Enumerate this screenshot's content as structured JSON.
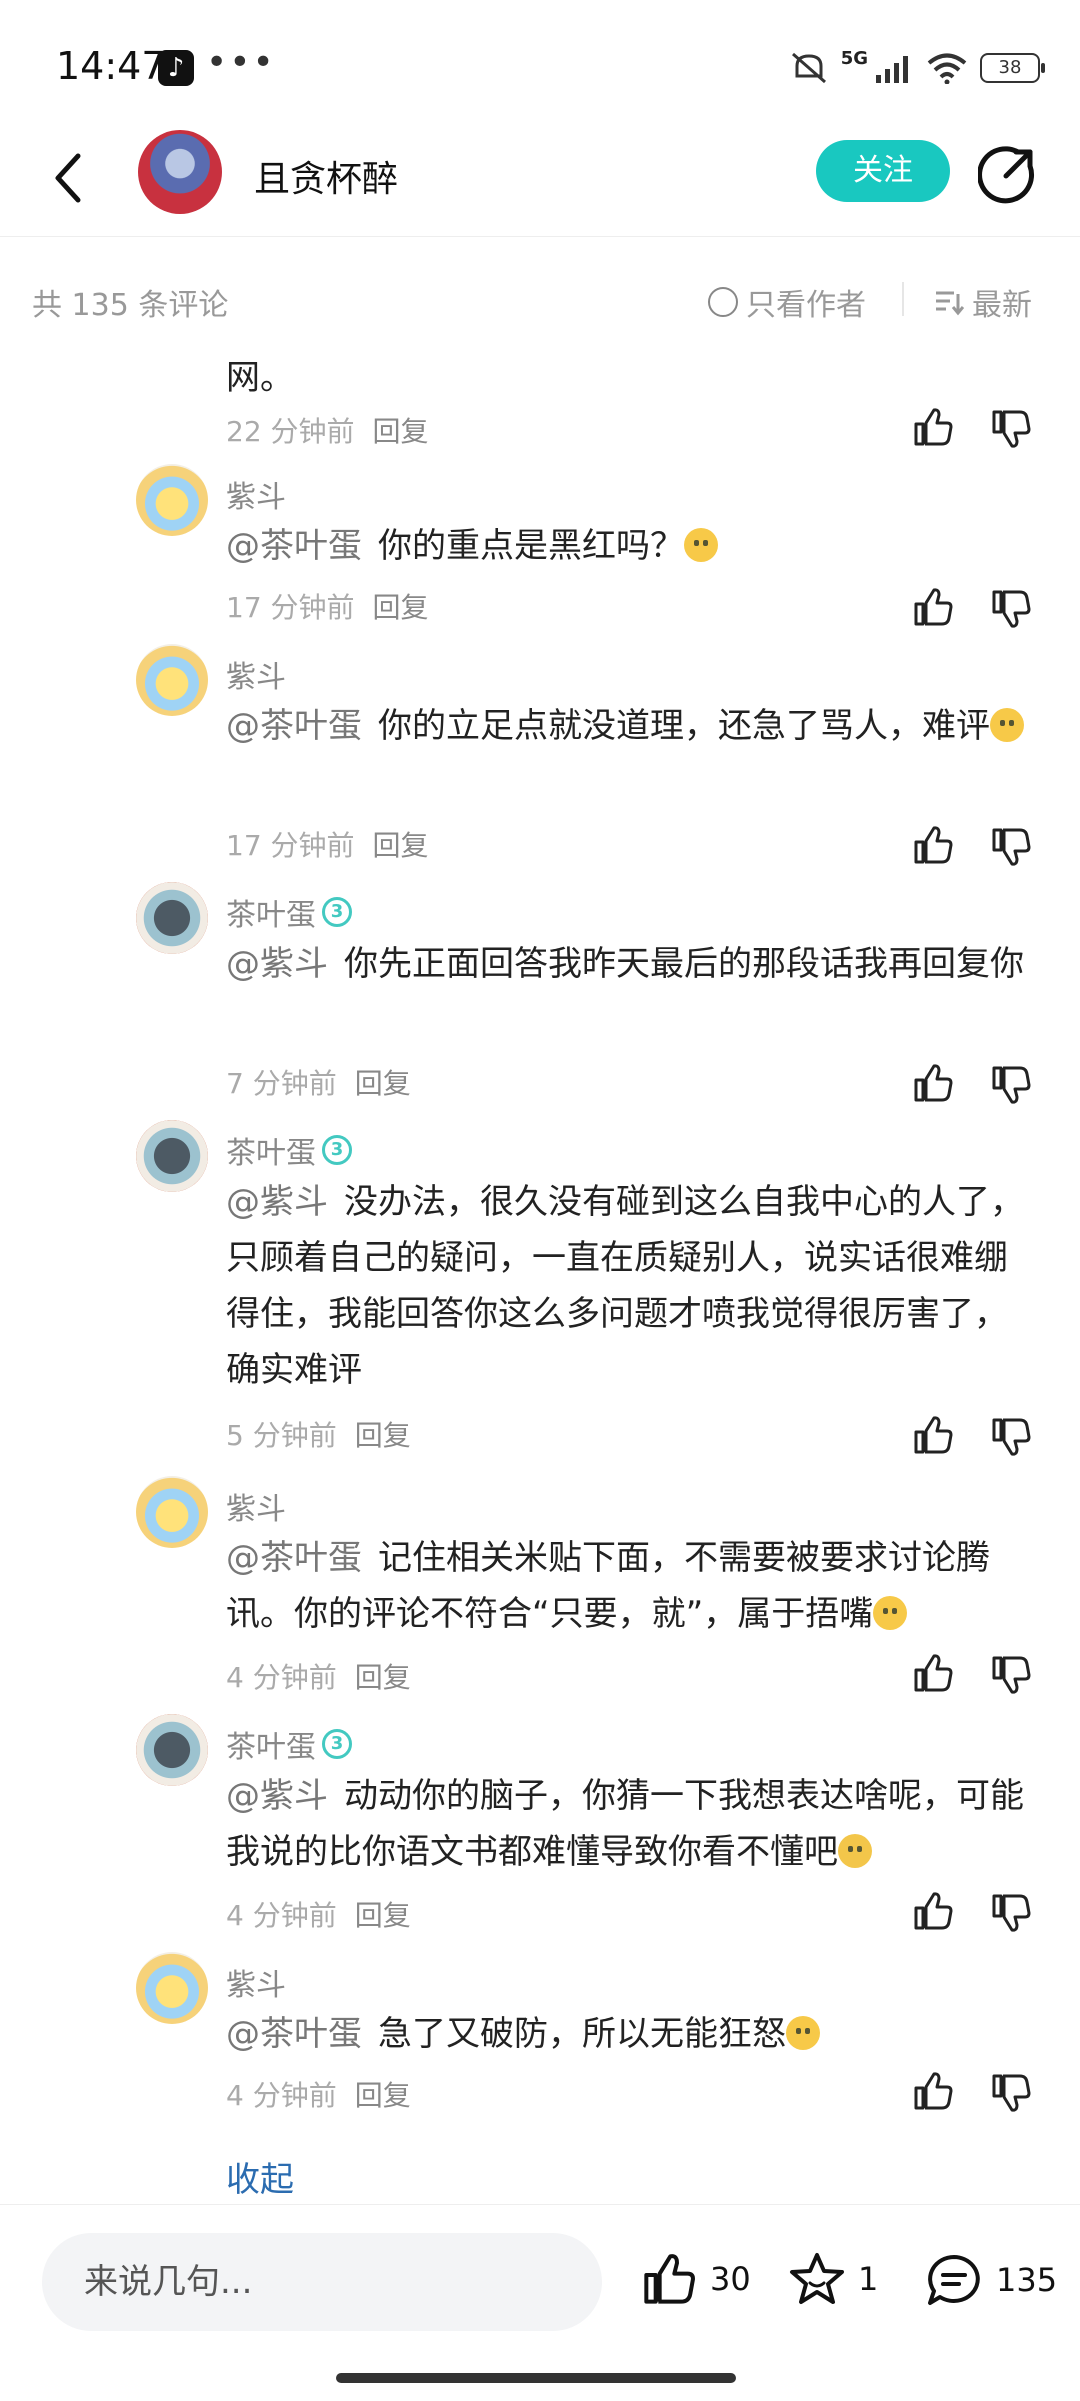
{
  "status_bar": {
    "time": "14:47",
    "network": "5G",
    "battery": "38"
  },
  "header": {
    "channel_name": "且贪杯醉",
    "follow_label": "关注"
  },
  "subbar": {
    "count": "共 135 条评论",
    "author_only": "只看作者",
    "sort": "最新"
  },
  "comments": [
    {
      "text": "网。",
      "time": "22 分钟前",
      "reply": "回复"
    },
    {
      "user": "紫斗",
      "mention": "@茶叶蛋",
      "text": "你的重点是黑红吗？",
      "emoji": "emoji-awkward",
      "time": "17 分钟前",
      "reply": "回复"
    },
    {
      "user": "紫斗",
      "mention": "@茶叶蛋",
      "text": "你的立足点就没道理，还急了骂人，难评",
      "emoji": "emoji-awkward",
      "time": "17 分钟前",
      "reply": "回复"
    },
    {
      "user": "茶叶蛋",
      "badge": "3",
      "mention": "@紫斗",
      "text": "你先正面回答我昨天最后的那段话我再回复你",
      "time": "7 分钟前",
      "reply": "回复"
    },
    {
      "user": "茶叶蛋",
      "badge": "3",
      "mention": "@紫斗",
      "text": "没办法，很久没有碰到这么自我中心的人了，只顾着自己的疑问，一直在质疑别人，说实话很难绷得住，我能回答你这么多问题才喷我觉得很厉害了，确实难评",
      "time": "5 分钟前",
      "reply": "回复"
    },
    {
      "user": "紫斗",
      "mention": "@茶叶蛋",
      "text": "记住相关米贴下面，不需要被要求讨论腾讯。你的评论不符合“只要，就”，属于捂嘴",
      "emoji": "emoji-awkward",
      "time": "4 分钟前",
      "reply": "回复"
    },
    {
      "user": "茶叶蛋",
      "badge": "3",
      "mention": "@紫斗",
      "text": "动动你的脑子，你猜一下我想表达啥呢，可能我说的比你语文书都难懂导致你看不懂吧",
      "emoji": "emoji-clown",
      "time": "4 分钟前",
      "reply": "回复"
    },
    {
      "user": "紫斗",
      "mention": "@茶叶蛋",
      "text": "急了又破防，所以无能狂怒",
      "emoji": "emoji-awkward",
      "time": "4 分钟前",
      "reply": "回复"
    }
  ],
  "collapse_label": "收起",
  "bottom": {
    "placeholder": "来说几句...",
    "likes": "30",
    "favorites": "1",
    "comments": "135"
  },
  "colors": {
    "accent": "#19c8c0",
    "link": "#2b6cb0"
  }
}
